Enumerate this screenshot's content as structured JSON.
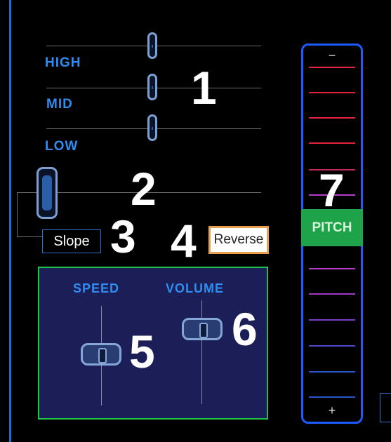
{
  "eq": {
    "high_label": "HIGH",
    "mid_label": "MID",
    "low_label": "LOW"
  },
  "callouts": {
    "n1": "1",
    "n2": "2",
    "n3": "3",
    "n4": "4",
    "n5": "5",
    "n6": "6",
    "n7": "7"
  },
  "buttons": {
    "slope": "Slope",
    "reverse": "Reverse"
  },
  "panel": {
    "speed_label": "SPEED",
    "volume_label": "VOLUME"
  },
  "pitch": {
    "minus": "−",
    "label": "PITCH",
    "plus": "+"
  },
  "colors": {
    "accent": "#2f8cf0",
    "panel_bg": "#1c1f57",
    "panel_border": "#21c14a",
    "pitch_border": "#1d5bff",
    "pitch_label_bg": "#1fa34a",
    "reverse_border": "#e8a14a",
    "tick_red": "#e3233a",
    "tick_magenta": "#b43cc8",
    "tick_blue": "#2a56c8"
  }
}
